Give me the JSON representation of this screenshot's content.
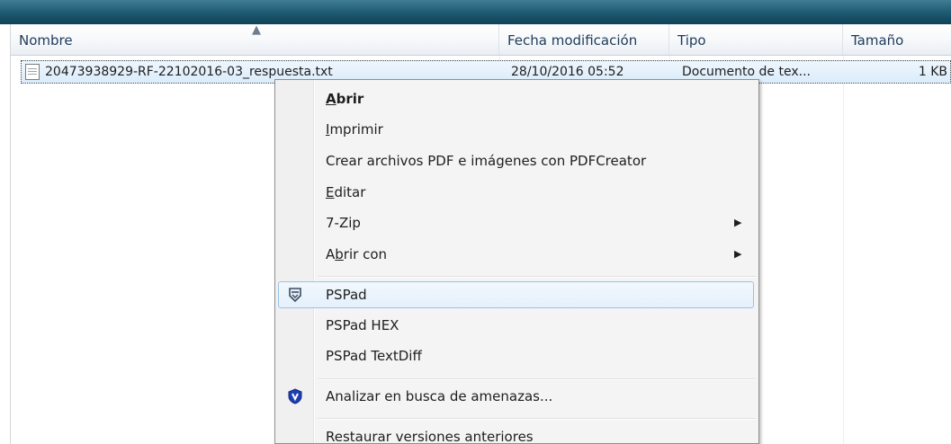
{
  "header": {
    "col_name": "Nombre",
    "col_date": "Fecha modificación",
    "col_type": "Tipo",
    "col_size": "Tamaño"
  },
  "file": {
    "name": "20473938929-RF-22102016-03_respuesta.txt",
    "date": "28/10/2016 05:52",
    "type": "Documento de tex...",
    "size": "1 KB",
    "icon": "text-file-icon"
  },
  "context_menu": {
    "open": {
      "u": "A",
      "rest": "brir"
    },
    "print": {
      "u": "I",
      "rest": "mprimir"
    },
    "pdfcreator": "Crear archivos PDF e imágenes con PDFCreator",
    "edit": {
      "u": "E",
      "rest": "ditar"
    },
    "zip": "7-Zip",
    "open_with": {
      "pre": "A",
      "u": "b",
      "rest": "rir con"
    },
    "pspad": "PSPad",
    "pspad_hex": "PSPad HEX",
    "pspad_textdiff": "PSPad TextDiff",
    "scan": "Analizar en busca de amenazas...",
    "restore": "Restaurar versiones anteriores",
    "submenu_arrow": "▶",
    "pspad_icon": "pspad-icon",
    "scan_icon": "shield-scan-icon",
    "accent_hover": "#9cc3e4"
  }
}
